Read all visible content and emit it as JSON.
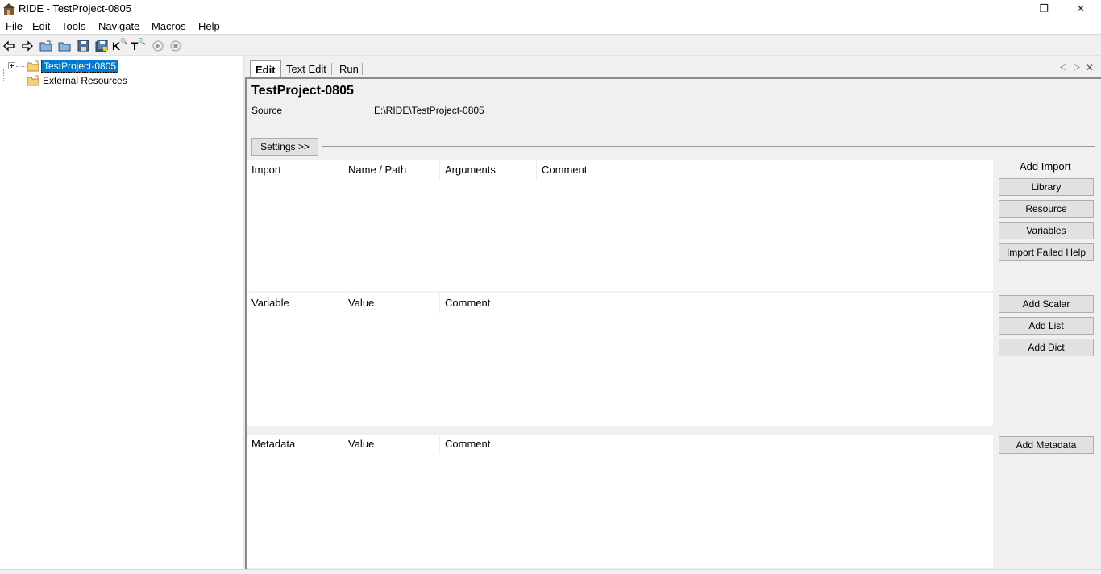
{
  "window": {
    "title": "RIDE - TestProject-0805",
    "minimize_glyph": "—",
    "maximize_glyph": "❐",
    "close_glyph": "✕"
  },
  "menu": [
    "File",
    "Edit",
    "Tools",
    "Navigate",
    "Macros",
    "Help"
  ],
  "toolbar": {
    "buttons": [
      {
        "icon": "back-arrow-icon"
      },
      {
        "icon": "forward-arrow-icon"
      },
      {
        "icon": "open-project-icon"
      },
      {
        "icon": "open-directory-icon"
      },
      {
        "icon": "save-icon"
      },
      {
        "icon": "save-all-icon"
      },
      {
        "icon": "search-keywords-icon",
        "glyph": "K"
      },
      {
        "icon": "search-tests-icon",
        "glyph": "T"
      },
      {
        "icon": "run-icon"
      },
      {
        "icon": "stop-icon"
      }
    ]
  },
  "tree": {
    "items": [
      {
        "label": "TestProject-0805",
        "selected": true
      },
      {
        "label": "External Resources",
        "selected": false
      }
    ]
  },
  "tabs": [
    "Edit",
    "Text Edit",
    "Run"
  ],
  "editor": {
    "title": "TestProject-0805",
    "source_label": "Source",
    "source_value": "E:\\RIDE\\TestProject-0805",
    "settings_button": "Settings >>",
    "import_table": {
      "columns": [
        "Import",
        "Name / Path",
        "Arguments",
        "Comment"
      ]
    },
    "variable_table": {
      "columns": [
        "Variable",
        "Value",
        "Comment"
      ]
    },
    "metadata_table": {
      "columns": [
        "Metadata",
        "Value",
        "Comment"
      ]
    },
    "add_import_label": "Add Import",
    "import_buttons": [
      "Library",
      "Resource",
      "Variables",
      "Import Failed Help"
    ],
    "variable_buttons": [
      "Add Scalar",
      "Add List",
      "Add Dict"
    ],
    "metadata_buttons": [
      "Add Metadata"
    ]
  }
}
